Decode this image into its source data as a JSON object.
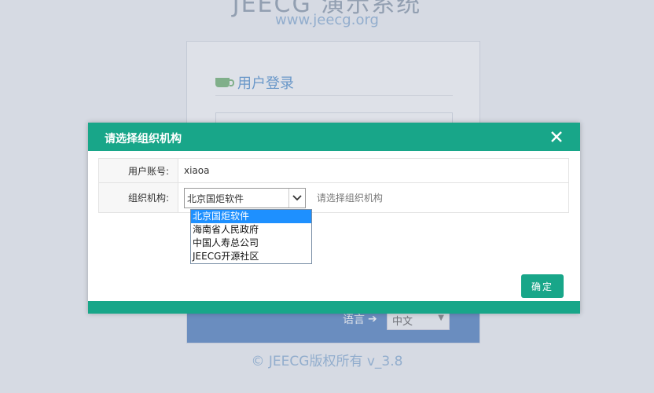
{
  "background": {
    "brand_title": "JEECG 演示系统",
    "brand_url": "www.jeecg.org",
    "login_title": "用户登录",
    "language_label": "语言",
    "language_value": "中文",
    "copyright": "© JEECG版权所有 v_3.8"
  },
  "modal": {
    "title": "请选择组织机构",
    "account_label": "用户账号:",
    "account_value": "xiaoa",
    "org_label": "组织机构:",
    "org_selected": "北京国炬软件",
    "org_hint": "请选择组织机构",
    "org_options": [
      "北京国炬软件",
      "海南省人民政府",
      "中国人寿总公司",
      "JEECG开源社区"
    ],
    "confirm_label": "确定"
  },
  "colors": {
    "accent": "#18a689",
    "dropdown_highlight": "#1e90ff"
  }
}
